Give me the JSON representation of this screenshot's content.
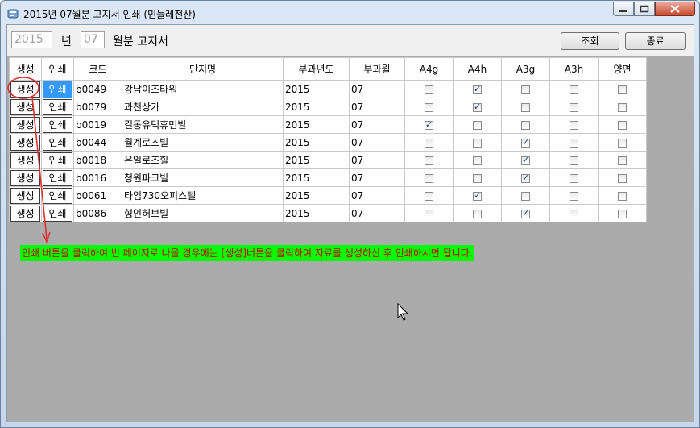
{
  "window": {
    "title": "2015년 07월분 고지서 인쇄 (민들레전산)"
  },
  "toolbar": {
    "year_value": "2015",
    "year_label": "년",
    "month_value": "07",
    "month_label": "월분 고지서",
    "search_label": "조회",
    "close_label": "종료"
  },
  "table": {
    "headers": [
      "생성",
      "인쇄",
      "코드",
      "단지명",
      "부과년도",
      "부과월",
      "A4g",
      "A4h",
      "A3g",
      "A3h",
      "양면"
    ],
    "rows": [
      {
        "gen": "생성",
        "print": "인쇄",
        "code": "b0049",
        "name": "강남이즈타워",
        "year": "2015",
        "month": "07",
        "a4g": false,
        "a4h": true,
        "a3g": false,
        "a3h": false,
        "duplex": false
      },
      {
        "gen": "생성",
        "print": "인쇄",
        "code": "b0079",
        "name": "과천상가",
        "year": "2015",
        "month": "07",
        "a4g": false,
        "a4h": true,
        "a3g": false,
        "a3h": false,
        "duplex": false
      },
      {
        "gen": "생성",
        "print": "인쇄",
        "code": "b0019",
        "name": "길동유덕휴먼빌",
        "year": "2015",
        "month": "07",
        "a4g": true,
        "a4h": false,
        "a3g": false,
        "a3h": false,
        "duplex": false
      },
      {
        "gen": "생성",
        "print": "인쇄",
        "code": "b0044",
        "name": "월계로즈빌",
        "year": "2015",
        "month": "07",
        "a4g": false,
        "a4h": false,
        "a3g": true,
        "a3h": false,
        "duplex": false
      },
      {
        "gen": "생성",
        "print": "인쇄",
        "code": "b0018",
        "name": "은일로즈힐",
        "year": "2015",
        "month": "07",
        "a4g": false,
        "a4h": false,
        "a3g": true,
        "a3h": false,
        "duplex": false
      },
      {
        "gen": "생성",
        "print": "인쇄",
        "code": "b0016",
        "name": "청원파크빌",
        "year": "2015",
        "month": "07",
        "a4g": false,
        "a4h": false,
        "a3g": true,
        "a3h": false,
        "duplex": false
      },
      {
        "gen": "생성",
        "print": "인쇄",
        "code": "b0061",
        "name": "타임730오피스텔",
        "year": "2015",
        "month": "07",
        "a4g": false,
        "a4h": true,
        "a3g": false,
        "a3h": false,
        "duplex": false
      },
      {
        "gen": "생성",
        "print": "인쇄",
        "code": "b0086",
        "name": "형인허브빌",
        "year": "2015",
        "month": "07",
        "a4g": false,
        "a4h": false,
        "a3g": true,
        "a3h": false,
        "duplex": false
      }
    ]
  },
  "notice": "인쇄 버튼을 클릭하여 빈 페이지로 나올 경우에는 [생성]버튼을 클릭하여 자료를 생성하신 후 인쇄하시면 됩니다.",
  "icons": {
    "app": "app-icon",
    "min": "minimize-icon",
    "max": "maximize-icon",
    "close": "close-icon",
    "cursor": "mouse-cursor-icon"
  },
  "colors": {
    "notice_bg": "#00ff00",
    "notice_text": "#cc0000",
    "annotation": "#e03030",
    "selected_button": "#3399ff"
  }
}
